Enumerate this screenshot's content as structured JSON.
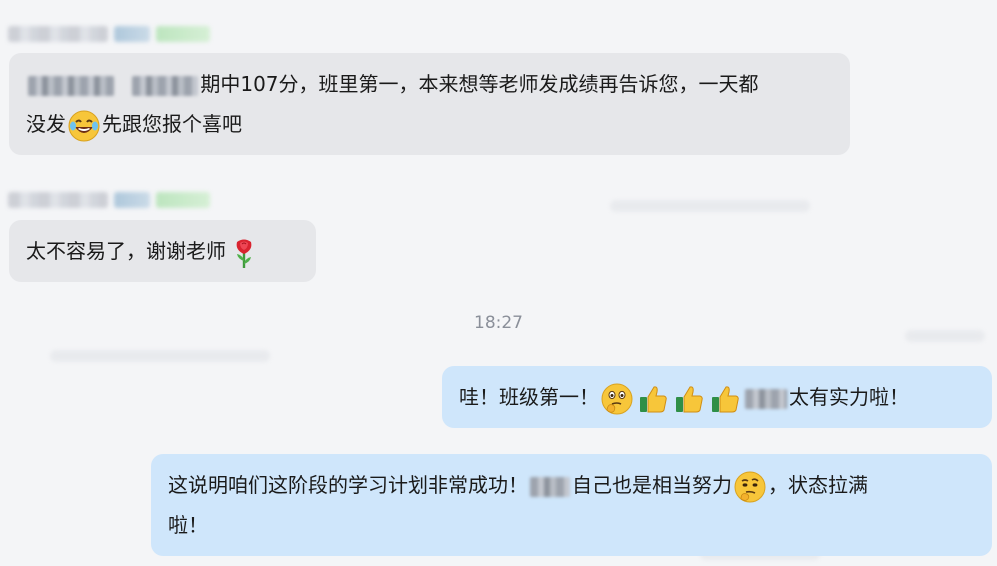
{
  "messages": {
    "m1": {
      "part1": "期中107分，班里第一，本来想等老师发成绩再告诉您，一天都",
      "part2a": "没发",
      "part2b": "先跟您报个喜吧",
      "emoji": "laughing-tears-emoji"
    },
    "m2": {
      "text": "太不容易了，谢谢老师",
      "emoji": "rose-emoji"
    },
    "timestamp": "18:27",
    "m3": {
      "part1": "哇！班级第一！",
      "part2": "太有实力啦！",
      "emojis": [
        "thinking-face-emoji",
        "thumbs-up-icon",
        "thumbs-up-icon",
        "thumbs-up-icon"
      ]
    },
    "m4": {
      "part1": "这说明咱们这阶段的学习计划非常成功！",
      "part2": "自己也是相当努力",
      "part3": "，状态拉满",
      "part4": "啦！",
      "emoji": "thinking-face-emoji"
    }
  },
  "colors": {
    "background": "#f4f5f7",
    "incoming_bubble": "#e6e7ea",
    "outgoing_bubble": "#cfe6fb",
    "timestamp_text": "#8a8f99"
  }
}
